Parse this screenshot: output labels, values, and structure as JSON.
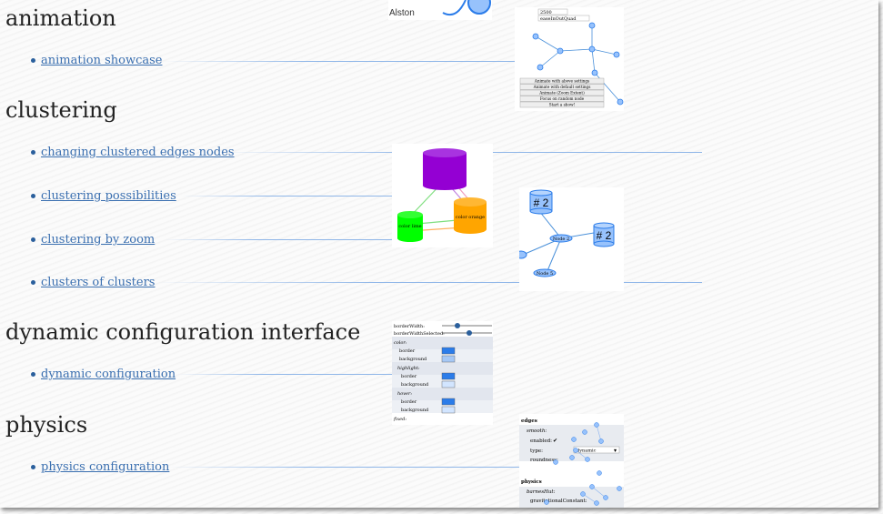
{
  "sections": [
    {
      "title": "animation",
      "links": [
        "animation showcase"
      ]
    },
    {
      "title": "clustering",
      "links": [
        "changing clustered edges nodes",
        "clustering possibilities",
        "clustering by zoom",
        "clusters of clusters"
      ]
    },
    {
      "title": "dynamic configuration interface",
      "links": [
        "dynamic configuration"
      ]
    },
    {
      "title": "physics",
      "links": [
        "physics configuration"
      ]
    }
  ],
  "thumbs": {
    "top_label": "Alston",
    "animation": {
      "field_values": [
        "2500",
        "easeInOutQuad"
      ],
      "buttons": [
        "Animate with above settings",
        "Animate with default settings",
        "Animate (Zoom Extent)",
        "Focus on random node",
        "Start a show!"
      ]
    },
    "clustering": {
      "node_labels": [
        "color lime",
        "color orange"
      ]
    },
    "zoom": {
      "labels": [
        "# 2",
        "# 2",
        "Node 2",
        "Node 5"
      ]
    },
    "config": {
      "labels": [
        "borderWidth:",
        "borderWidthSelected:",
        "color:",
        "border",
        "background",
        "highlight:",
        "border",
        "background",
        "hover:",
        "border",
        "background",
        "fixed:"
      ],
      "colors": {
        "blue": "#2b7ce9",
        "light": "#d2e5ff",
        "panel_a": "#e2e6ee",
        "panel_b": "#edf0f5"
      }
    },
    "physics": {
      "labels": [
        "edges",
        "smooth:",
        "enabled:",
        "type:",
        "roundness:",
        "physics",
        "barnesHut:",
        "gravitationalConstant:"
      ],
      "select_value": "dynamic"
    }
  },
  "colors": {
    "link": "#3a6fb0",
    "title": "#222222",
    "node_blue": "#97c2fc",
    "node_border": "#2b7ce9",
    "purple": "#9400d3",
    "lime": "#00ff00",
    "orange": "#ffa500"
  }
}
